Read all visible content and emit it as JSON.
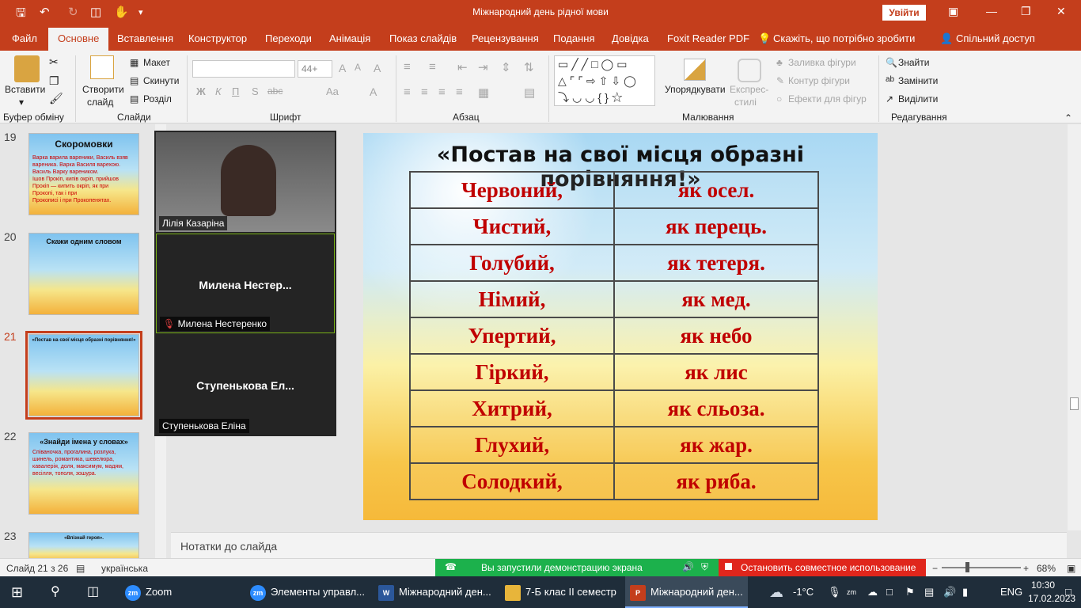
{
  "window": {
    "title": "Міжнародний день рідної мови",
    "signin_label": "Увійти"
  },
  "tabs": [
    "Файл",
    "Основне",
    "Вставлення",
    "Конструктор",
    "Переходи",
    "Анімація",
    "Показ слайдів",
    "Рецензування",
    "Подання",
    "Довідка",
    "Foxit Reader PDF",
    "Скажіть, що потрібно зробити",
    "Спільний доступ"
  ],
  "ribbon": {
    "clipboard": {
      "paste": "Вставити",
      "label": "Буфер обміну"
    },
    "slides": {
      "new_slide": "Створити",
      "new_slide2": "слайд",
      "layout": "Макет",
      "reset": "Скинути",
      "section": "Розділ",
      "label": "Слайди"
    },
    "font": {
      "size": "44+",
      "label": "Шрифт",
      "bold": "Ж",
      "italic": "К",
      "underline": "П",
      "strike": "S",
      "abc": "abc",
      "aa": "Aa",
      "color_a": "A"
    },
    "paragraph": {
      "label": "Абзац"
    },
    "drawing": {
      "arrange": "Упорядкувати",
      "quick_styles": "Експрес-",
      "quick_styles2": "стилі",
      "fill": "Заливка фігури",
      "outline": "Контур фігури",
      "effects": "Ефекти для фігур",
      "label": "Малювання"
    },
    "editing": {
      "find": "Знайти",
      "replace": "Замінити",
      "select": "Виділити",
      "label": "Редагування"
    }
  },
  "thumbnails": [
    {
      "num": "19",
      "title": "Скоромовки",
      "lines": [
        "Варка варила вареники, Василь взяв вареника. Варка Василя варехою. Василь Варку вареником.",
        "Ішов Прокіп, кипів окріп, прийшов Прокіп — кипить окріп, як при",
        "Прокопі, так і при",
        "Прокописі і при Прокопенятах."
      ]
    },
    {
      "num": "20",
      "title": "Скажи одним словом",
      "lines": []
    },
    {
      "num": "21",
      "title": "«Постав на свої місця образні порівняння!»",
      "lines": []
    },
    {
      "num": "22",
      "title": "«Знайди імена у словах»",
      "lines": [
        "Співаночка, прогалина, розлука, шинель, романтика, шевелюра, кавалерія, доля, максимум, мадям, весілля, тополя, зошура."
      ]
    },
    {
      "num": "23",
      "title": "«Впізнай героя».",
      "lines": []
    }
  ],
  "zoom": {
    "participants": [
      {
        "name": "Лілія Казаріна",
        "center": ""
      },
      {
        "name": "Милена Нестеренко",
        "center": "Милена  Нестер..."
      },
      {
        "name": "Ступенькова Еліна",
        "center": "Ступенькова  Ел..."
      }
    ]
  },
  "slide": {
    "title": "«Постав на свої місця образні порівняння!»",
    "rows": [
      [
        "Червоний,",
        "як осел."
      ],
      [
        "Чистий,",
        "як перець."
      ],
      [
        "Голубий,",
        "як тетеря."
      ],
      [
        "Німий,",
        "як мед."
      ],
      [
        "Упертий,",
        "як небо"
      ],
      [
        "Гіркий,",
        "як лис"
      ],
      [
        "Хитрий,",
        "як сльоза."
      ],
      [
        "Глухий,",
        "як жар."
      ],
      [
        "Солодкий,",
        "як риба."
      ]
    ]
  },
  "notes_placeholder": "Нотатки до слайда",
  "status": {
    "slide_counter": "Слайд 21 з 26",
    "language": "українська",
    "sharing_notice": "Вы запустили демонстрацию экрана",
    "stop_sharing": "Остановить совместное использование",
    "zoom_level": "68%"
  },
  "taskbar": {
    "items": [
      "Zoom",
      "Элементы управл...",
      "Міжнародний ден...",
      "7-Б клас II семестр",
      "Міжнародний ден..."
    ],
    "weather": "-1°C",
    "lang": "ENG",
    "time": "10:30",
    "date": "17.02.2023"
  }
}
